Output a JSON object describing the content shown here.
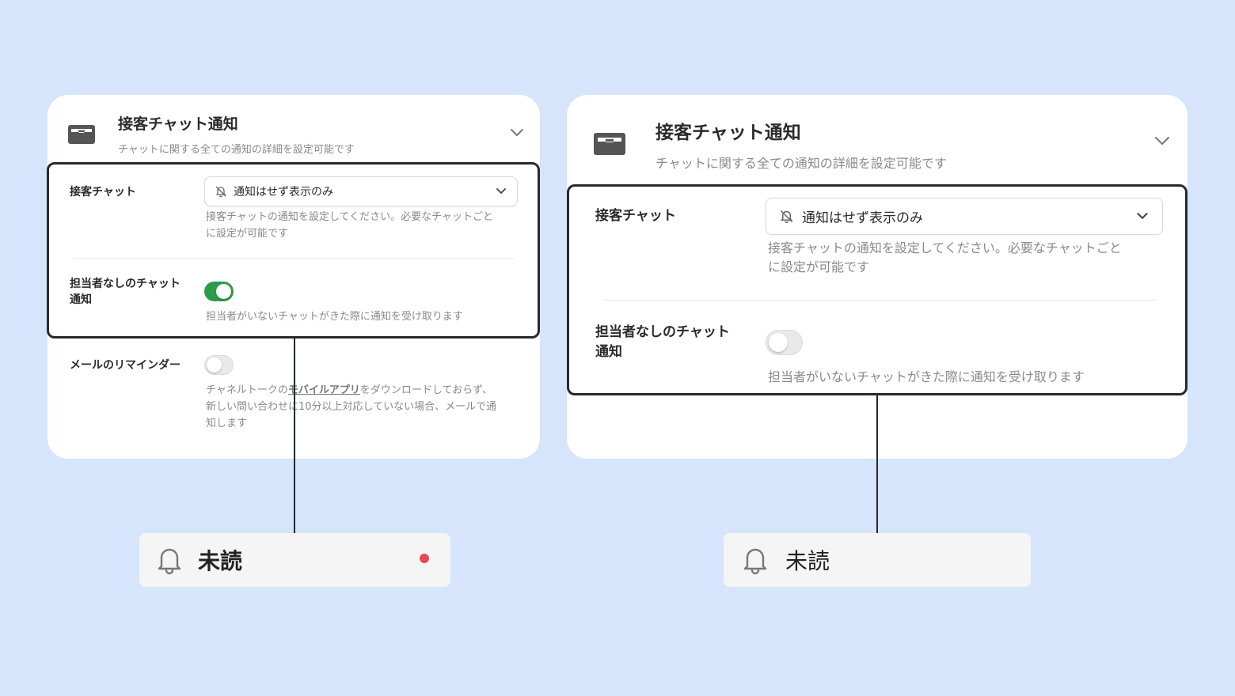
{
  "left_card": {
    "title": "接客チャット通知",
    "description": "チャットに関する全ての通知の詳細を設定可能です",
    "rows": [
      {
        "label": "接客チャット",
        "select_value": "通知はせず表示のみ",
        "help_line1": "接客チャットの通知を設定してください。必要なチャットごと",
        "help_line2": "に設定が可能です"
      },
      {
        "label_line1": "担当者なしのチャット",
        "label_line2": "通知",
        "toggle_state": "on",
        "help": "担当者がいないチャットがきた際に通知を受け取ります"
      },
      {
        "label": "メールのリマインダー",
        "toggle_state": "off",
        "help_part1": "チャネルトークの",
        "help_link": "モバイルアプリ",
        "help_part2": "をダウンロードしておらず、",
        "help_line2": "新しい問い合わせに10分以上対応していない場合、メールで通",
        "help_line3": "知します"
      }
    ]
  },
  "right_card": {
    "title": "接客チャット通知",
    "description": "チャットに関する全ての通知の詳細を設定可能です",
    "rows": [
      {
        "label": "接客チャット",
        "select_value": "通知はせず表示のみ",
        "help_line1": "接客チャットの通知を設定してください。必要なチャットごと",
        "help_line2": "に設定が可能です"
      },
      {
        "label_line1": "担当者なしのチャット",
        "label_line2": "通知",
        "toggle_state": "off",
        "help": "担当者がいないチャットがきた際に通知を受け取ります"
      }
    ]
  },
  "left_notification": {
    "label": "未読",
    "unread_dot": true
  },
  "right_notification": {
    "label": "未読",
    "unread_dot": false
  },
  "colors": {
    "background": "#d6e4fc",
    "toggle_on": "#2e9b4c",
    "unread_dot": "#e8465a",
    "highlight_border": "#262a30"
  },
  "icons": {
    "section_icon": "inbox-icon",
    "collapse_icon": "chevron-down-icon",
    "select_icon": "bell-off-icon",
    "notification_icon": "bell-icon"
  }
}
